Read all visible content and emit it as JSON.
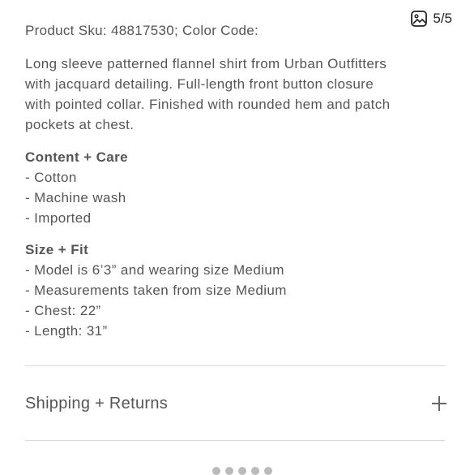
{
  "header": {
    "sku_line": "Product Sku: 48817530; Color Code:",
    "image_counter": "5/5",
    "image_icon": "image-icon"
  },
  "description": "Long sleeve patterned flannel shirt from Urban Outfitters\nwith jacquard detailing. Full-length front button closure\nwith pointed collar. Finished with rounded hem and patch\npockets at chest.",
  "content_care": {
    "heading": "Content + Care",
    "items": [
      "- Cotton",
      "- Machine wash",
      "- Imported"
    ]
  },
  "size_fit": {
    "heading": "Size + Fit",
    "items": [
      "- Model is 6’3” and wearing size Medium",
      "- Measurements taken from size Medium",
      "- Chest: 22”",
      "- Length: 31”"
    ]
  },
  "accordion": {
    "label": "Shipping + Returns",
    "icon": "plus-icon"
  }
}
